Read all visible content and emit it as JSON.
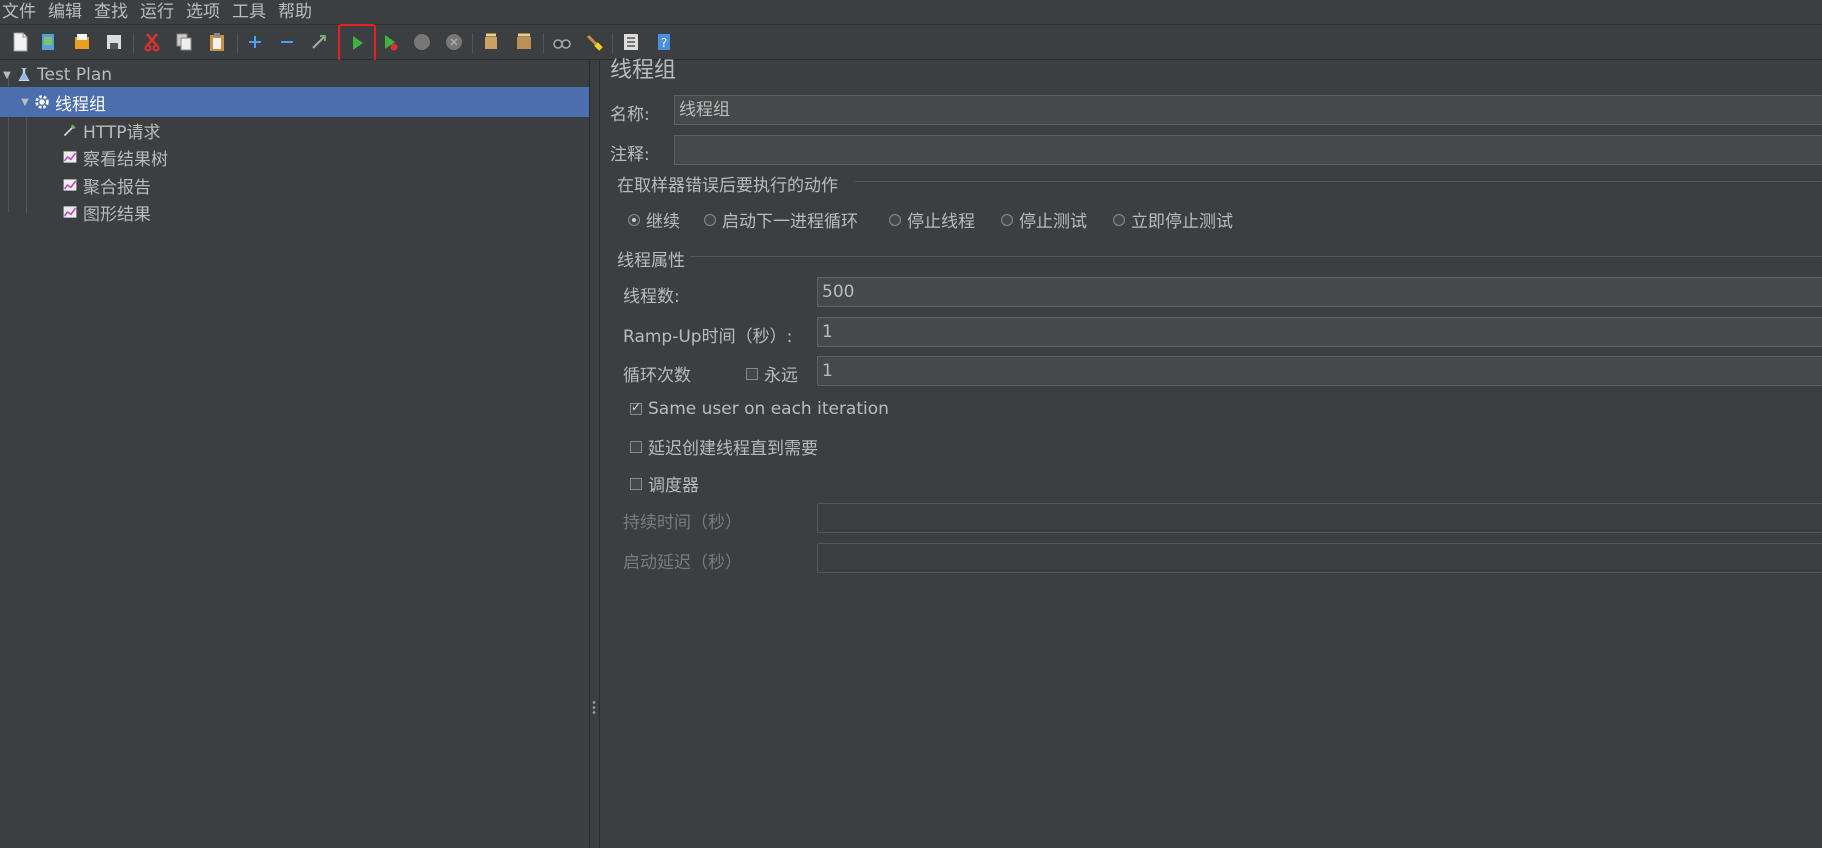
{
  "menu": [
    "文件",
    "编辑",
    "查找",
    "运行",
    "选项",
    "工具",
    "帮助"
  ],
  "toolbar": {
    "icons": [
      "new-icon",
      "templates-icon",
      "open-icon",
      "save-icon",
      "cut-icon",
      "copy-icon",
      "paste-icon",
      "expand-icon",
      "collapse-icon",
      "toggle-icon",
      "start-icon",
      "start-no-pauses-icon",
      "stop-icon",
      "shutdown-icon",
      "clear-icon",
      "clear-all-icon",
      "search-icon",
      "reset-search-icon",
      "function-helper-icon",
      "help-icon"
    ],
    "highlight_color": "#e8201e"
  },
  "tree": {
    "root": "Test Plan",
    "thread_group": "线程组",
    "children": [
      "HTTP请求",
      "察看结果树",
      "聚合报告",
      "图形结果"
    ]
  },
  "panel": {
    "title": "线程组",
    "name_label": "名称:",
    "name_value": "线程组",
    "comment_label": "注释:",
    "comment_value": "",
    "error_action_title": "在取样器错误后要执行的动作",
    "error_actions": [
      {
        "label": "继续",
        "selected": true
      },
      {
        "label": "启动下一进程循环",
        "selected": false
      },
      {
        "label": "停止线程",
        "selected": false
      },
      {
        "label": "停止测试",
        "selected": false
      },
      {
        "label": "立即停止测试",
        "selected": false
      }
    ],
    "thread_props_title": "线程属性",
    "threads_label": "线程数:",
    "threads_value": "500",
    "rampup_label": "Ramp-Up时间（秒）:",
    "rampup_value": "1",
    "loop_label": "循环次数",
    "forever_label": "永远",
    "forever_checked": false,
    "loop_value": "1",
    "same_user_label": "Same user on each iteration",
    "same_user_checked": true,
    "delay_create_label": "延迟创建线程直到需要",
    "delay_create_checked": false,
    "scheduler_label": "调度器",
    "scheduler_checked": false,
    "duration_label": "持续时间（秒）",
    "duration_value": "",
    "startup_delay_label": "启动延迟（秒）",
    "startup_delay_value": ""
  },
  "colors": {
    "background": "#3c3f41",
    "selection": "#4b6eaf",
    "field": "#45494a"
  }
}
